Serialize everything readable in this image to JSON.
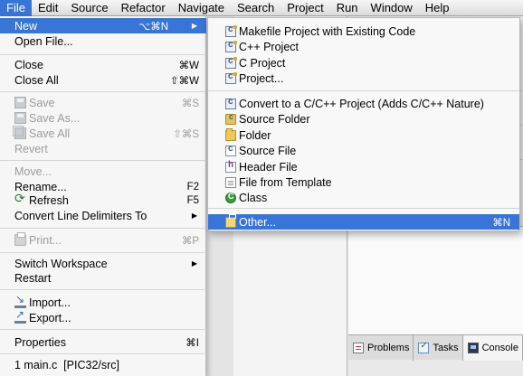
{
  "menubar": {
    "items": [
      "File",
      "Edit",
      "Source",
      "Refactor",
      "Navigate",
      "Search",
      "Project",
      "Run",
      "Window",
      "Help"
    ],
    "active_index": 0
  },
  "file_menu": {
    "items": [
      {
        "label": "New",
        "shortcut": "⌥⌘N",
        "submenu": true,
        "highlighted": true
      },
      {
        "label": "Open File..."
      },
      {
        "label": "Close",
        "shortcut": "⌘W"
      },
      {
        "label": "Close All",
        "shortcut": "⇧⌘W"
      },
      {
        "label": "Save",
        "shortcut": "⌘S",
        "disabled": true,
        "icon": "save-icon"
      },
      {
        "label": "Save As...",
        "disabled": true,
        "icon": "save-as-icon"
      },
      {
        "label": "Save All",
        "shortcut": "⇧⌘S",
        "disabled": true,
        "icon": "save-all-icon"
      },
      {
        "label": "Revert",
        "disabled": true
      },
      {
        "label": "Move...",
        "disabled": true
      },
      {
        "label": "Rename...",
        "shortcut": "F2"
      },
      {
        "label": "Refresh",
        "shortcut": "F5",
        "icon": "refresh-icon"
      },
      {
        "label": "Convert Line Delimiters To",
        "submenu": true
      },
      {
        "label": "Print...",
        "shortcut": "⌘P",
        "disabled": true,
        "icon": "print-icon"
      },
      {
        "label": "Switch Workspace",
        "submenu": true
      },
      {
        "label": "Restart"
      },
      {
        "label": "Import...",
        "icon": "import-icon"
      },
      {
        "label": "Export...",
        "icon": "export-icon"
      },
      {
        "label": "Properties",
        "shortcut": "⌘I"
      },
      {
        "label": "1 main.c  [PIC32/src]"
      }
    ]
  },
  "new_submenu": {
    "items": [
      {
        "label": "Makefile Project with Existing Code",
        "icon": "c-project-icon"
      },
      {
        "label": "C++ Project",
        "icon": "c-project-icon"
      },
      {
        "label": "C Project",
        "icon": "c-project-icon"
      },
      {
        "label": "Project...",
        "icon": "project-icon"
      },
      {
        "label": "Convert to a C/C++ Project (Adds C/C++ Nature)",
        "icon": "convert-icon"
      },
      {
        "label": "Source Folder",
        "icon": "source-folder-icon"
      },
      {
        "label": "Folder",
        "icon": "folder-icon"
      },
      {
        "label": "Source File",
        "icon": "source-file-icon"
      },
      {
        "label": "Header File",
        "icon": "header-file-icon"
      },
      {
        "label": "File from Template",
        "icon": "template-file-icon"
      },
      {
        "label": "Class",
        "icon": "class-icon"
      },
      {
        "label": "Other...",
        "shortcut": "⌘N",
        "icon": "other-icon",
        "highlighted": true
      }
    ]
  },
  "view_tabs": {
    "items": [
      {
        "label": "Problems",
        "icon": "problems-icon"
      },
      {
        "label": "Tasks",
        "icon": "tasks-icon"
      },
      {
        "label": "Console",
        "icon": "console-icon",
        "active": true
      }
    ]
  },
  "colors": {
    "highlight": "#3875d7",
    "disabled_text": "#9b9b9b"
  }
}
